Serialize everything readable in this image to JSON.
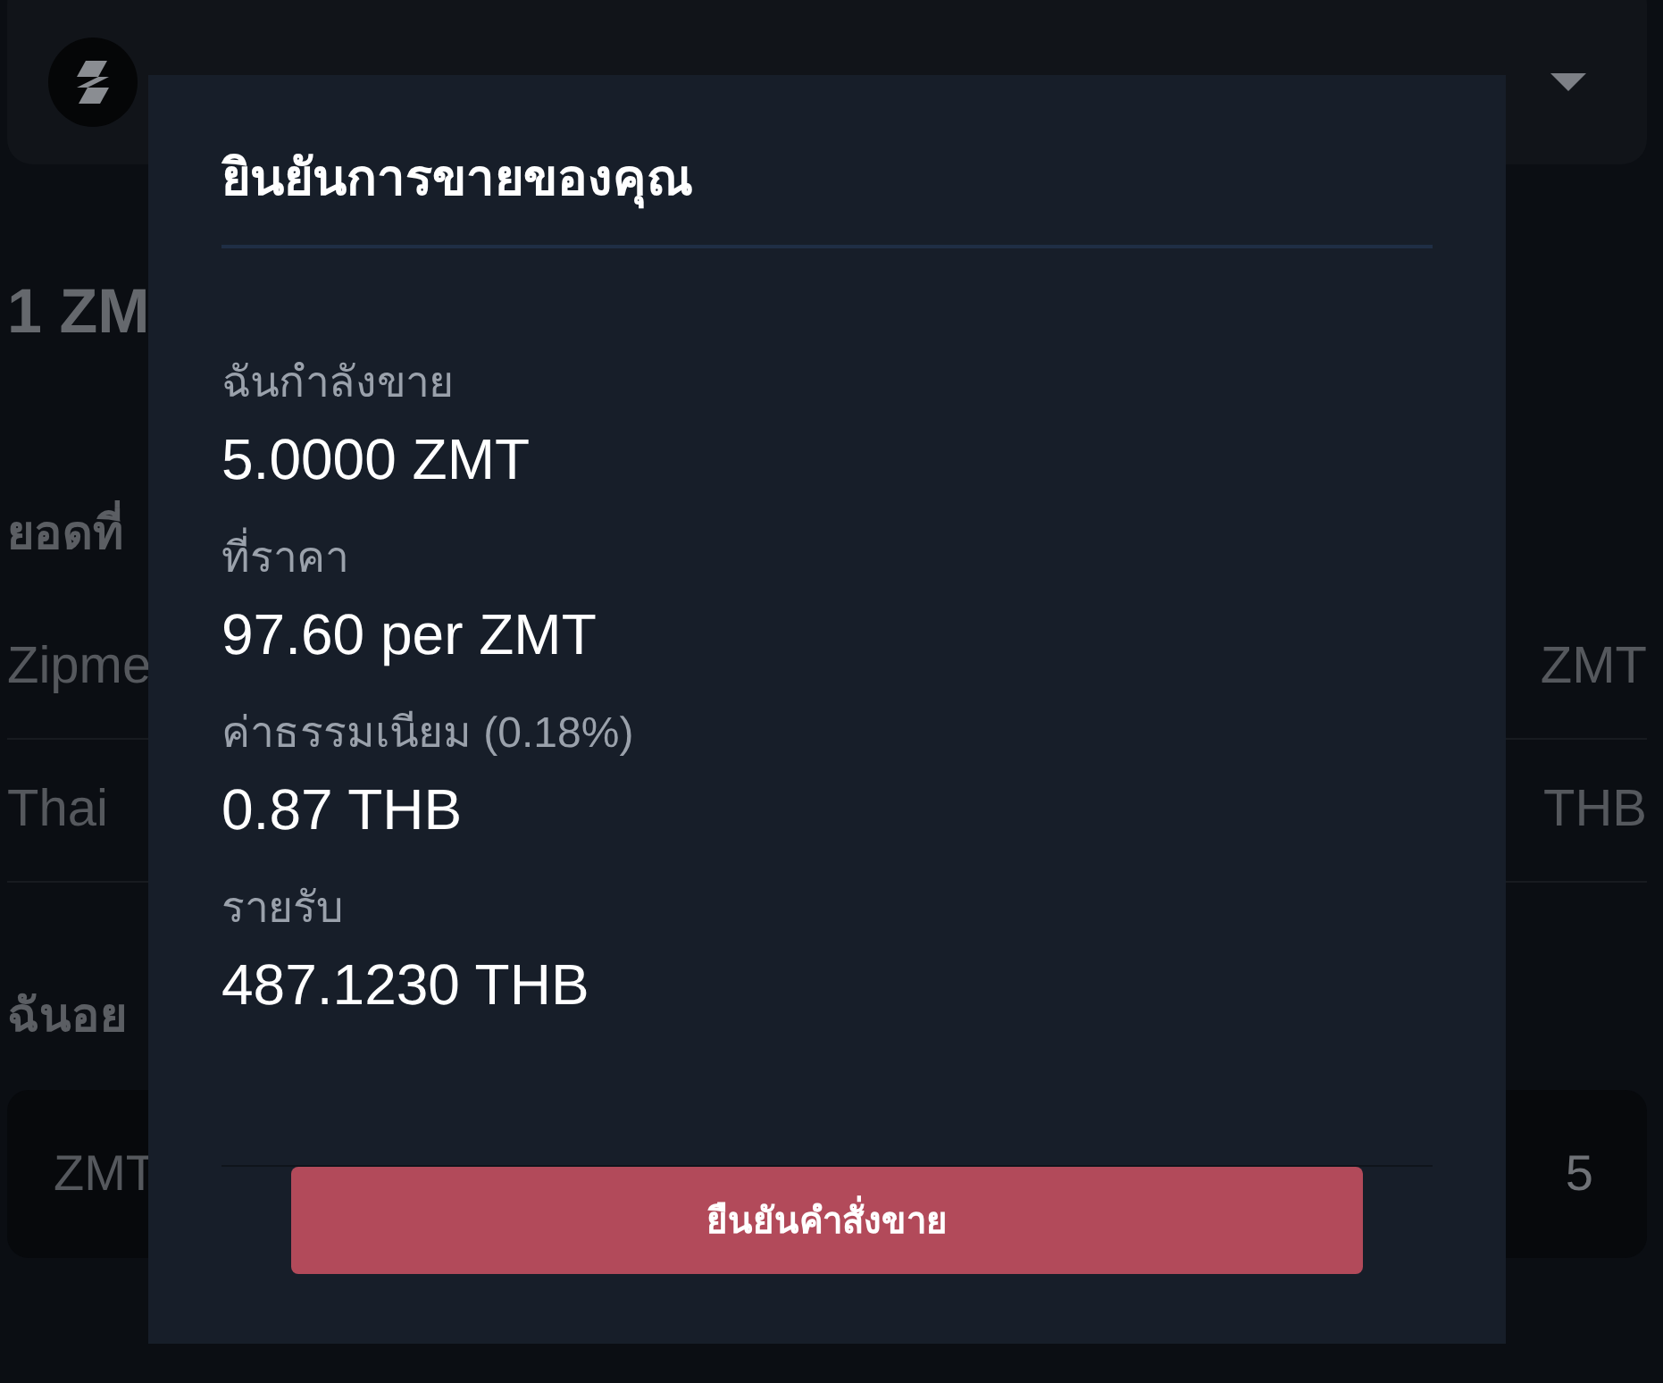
{
  "background": {
    "rate_heading": "1 ZM",
    "balance": {
      "heading": "ยอดที่",
      "rows": [
        {
          "name": "Zipme",
          "amount": "ZMT"
        },
        {
          "name": "Thai",
          "amount": "THB"
        }
      ]
    },
    "sell": {
      "heading": "ฉันอย",
      "input": {
        "unit": "ZMT",
        "value": "5"
      }
    }
  },
  "dialog": {
    "title": "ยินยันการขายของคุณ",
    "details": [
      {
        "label": "ฉันกำลังขาย",
        "value": "5.0000 ZMT"
      },
      {
        "label": "ที่ราคา",
        "value": "97.60 per ZMT"
      },
      {
        "label": "ค่าธรรมเนียม (0.18%)",
        "value": "0.87 THB"
      },
      {
        "label": "รายรับ",
        "value": "487.1230 THB"
      }
    ],
    "confirm_button": "ยืนยันคำสั่งขาย"
  }
}
